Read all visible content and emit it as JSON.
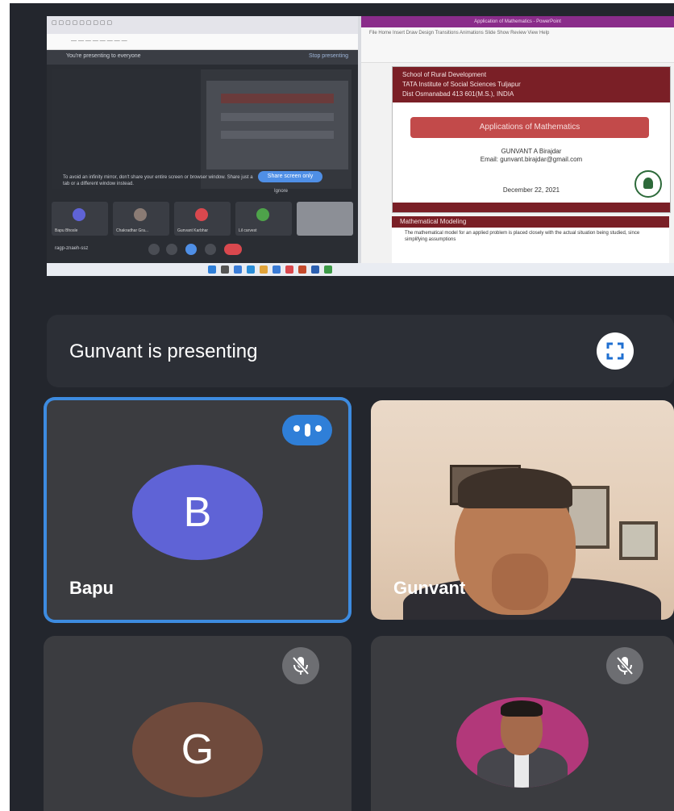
{
  "presentation": {
    "banner_text": "Gunvant is presenting",
    "fullscreen_icon": "fullscreen-icon",
    "screen": {
      "meet_bar_text": "You're presenting to everyone",
      "stop_text": "Stop presenting",
      "warning_text": "To avoid an infinity mirror, don't share your entire screen or browser window. Share just a tab or a different window instead.",
      "share_button": "Share screen only",
      "ignore_text": "Ignore",
      "tile_names": [
        "Bapu Bhosle",
        "Chakradhar Gra...",
        "Gunvant Karbhar",
        "Lil carvest"
      ],
      "meeting_code": "ragp-znaeh-ssz",
      "ppt_window_title": "Application of Mathematics - PowerPoint",
      "ppt_ribbon": "File  Home  Insert  Draw  Design  Transitions  Animations  Slide Show  Review  View  Help",
      "slide_header": [
        "School of Rural Development",
        "TATA Institute of Social Sciences Tuljapur",
        "Dist Osmanabad 413 601(M.S.), INDIA"
      ],
      "slide_title": "Applications of Mathematics",
      "slide_author": "GUNVANT A Birajdar",
      "slide_email": "Email: gunvant.birajdar@gmail.com",
      "slide_date": "December 22, 2021",
      "slide2_heading": "Mathematical Modeling",
      "slide2_text": "The mathematical model for an applied problem is placed closely with the actual situation being studied, since simplifying assumptions"
    }
  },
  "participants": [
    {
      "name": "Bapu",
      "initial": "B",
      "avatar_color": "#5f63d6",
      "state": "speaking",
      "active": true
    },
    {
      "name": "Gunvant",
      "type": "video",
      "state": "presenting"
    },
    {
      "name": "",
      "initial": "G",
      "avatar_color": "#6f4a3c",
      "state": "muted"
    },
    {
      "name": "",
      "type": "photo",
      "state": "muted"
    }
  ],
  "colors": {
    "background": "#23262d",
    "tile": "#3b3c40",
    "speaking_accent": "#2f7fd8",
    "active_border": "#3d8be0"
  },
  "icons": {
    "speaking": "audio-wave-icon",
    "muted": "mic-off-icon"
  }
}
